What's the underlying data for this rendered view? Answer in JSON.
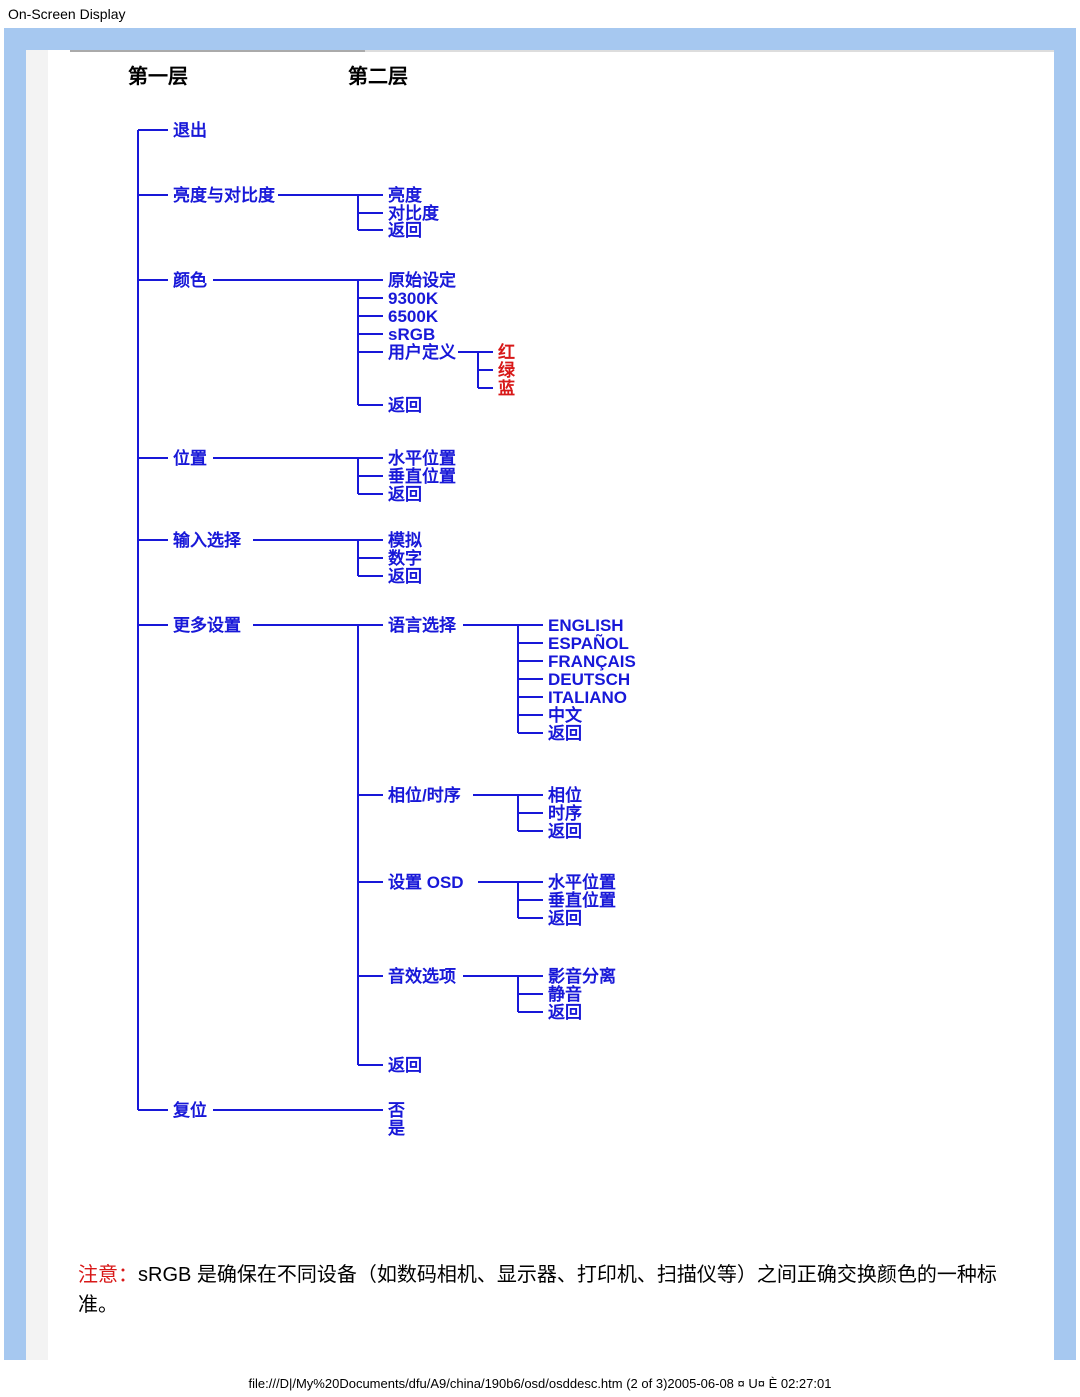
{
  "page_title": "On-Screen Display",
  "headers": {
    "level1": "第一层",
    "level2": "第二层"
  },
  "tree": {
    "exit": "退出",
    "brightness_contrast": {
      "label": "亮度与对比度",
      "children": [
        "亮度",
        "对比度",
        "返回"
      ]
    },
    "color": {
      "label": "颜色",
      "children": [
        "原始设定",
        "9300K",
        "6500K",
        "sRGB",
        "用户定义",
        "返回"
      ],
      "user_def_children": [
        "红",
        "绿",
        "蓝"
      ]
    },
    "position": {
      "label": "位置",
      "children": [
        "水平位置",
        "垂直位置",
        "返回"
      ]
    },
    "input": {
      "label": "输入选择",
      "children": [
        "模拟",
        "数字",
        "返回"
      ]
    },
    "more": {
      "label": "更多设置",
      "language": {
        "label": "语言选择",
        "children": [
          "ENGLISH",
          "ESPAÑOL",
          "FRANÇAIS",
          "DEUTSCH",
          "ITALIANO",
          "中文",
          "返回"
        ]
      },
      "phase": {
        "label": "相位/时序",
        "children": [
          "相位",
          "时序",
          "返回"
        ]
      },
      "osd": {
        "label": "设置 OSD",
        "children": [
          "水平位置",
          "垂直位置",
          "返回"
        ]
      },
      "audio": {
        "label": "音效选项",
        "children": [
          "影音分离",
          "静音",
          "返回"
        ]
      },
      "back": "返回"
    },
    "reset": {
      "label": "复位",
      "children": [
        "否",
        "是"
      ]
    }
  },
  "note": {
    "prefix": "注意：",
    "body": "sRGB 是确保在不同设备（如数码相机、显示器、打印机、扫描仪等）之间正确交换颜色的一种标准。"
  },
  "footer": "file:///D|/My%20Documents/dfu/A9/china/190b6/osd/osddesc.htm (2 of 3)2005-06-08 ¤ U¤ È 02:27:01"
}
